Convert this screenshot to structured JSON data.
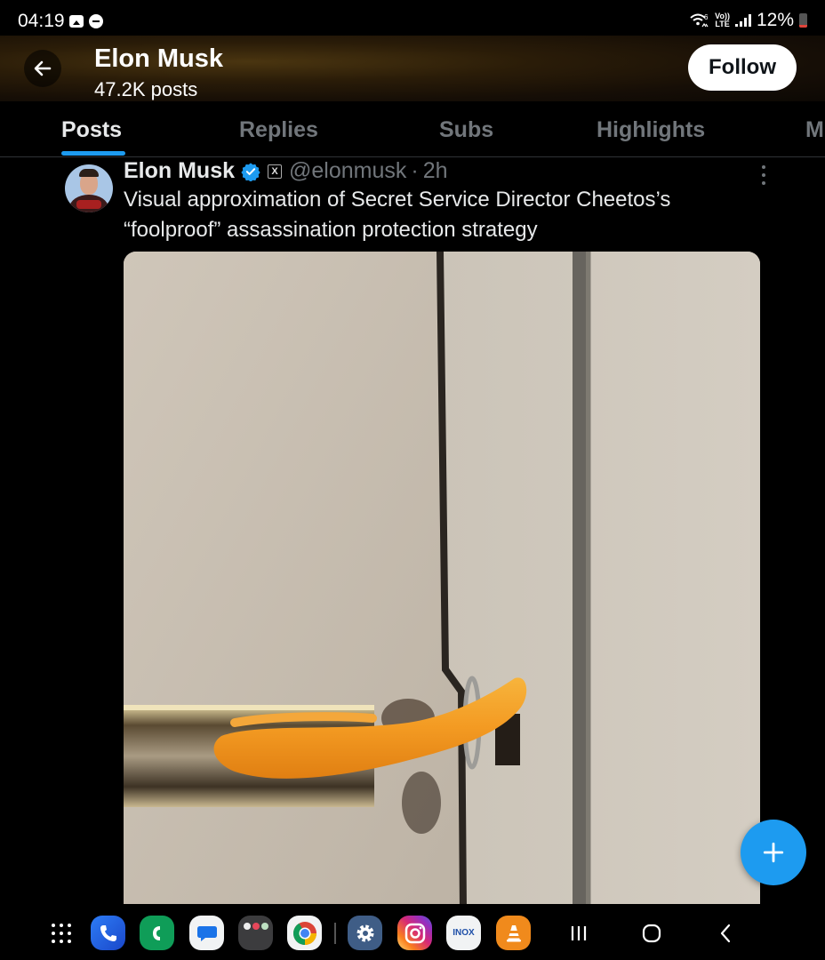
{
  "status_bar": {
    "time": "04:19",
    "left_icons": [
      "gallery-notification-icon",
      "do-not-disturb-icon"
    ],
    "wifi_label": "6",
    "network_label_top": "Vo))",
    "network_label_bottom": "LTE",
    "battery_percent": "12%"
  },
  "header": {
    "back_icon": "arrow-left-icon",
    "name": "Elon Musk",
    "posts_count": "47.2K posts",
    "follow_label": "Follow"
  },
  "tabs": [
    {
      "label": "Posts",
      "active": true
    },
    {
      "label": "Replies",
      "active": false
    },
    {
      "label": "Subs",
      "active": false
    },
    {
      "label": "Highlights",
      "active": false
    },
    {
      "label": "M",
      "active": false
    }
  ],
  "tweet": {
    "author_name": "Elon Musk",
    "verified": true,
    "affiliate_badge": "X",
    "handle": "@elonmusk",
    "separator": "·",
    "time": "2h",
    "text": "Visual approximation of Secret Service Director Cheetos’s “foolproof” assassination protection strategy",
    "media": {
      "type": "photo",
      "description": "Cheeto inserted through a door latch strike plate ring"
    }
  },
  "fab": {
    "icon": "plus-icon",
    "label": "Compose post"
  },
  "taskbar": {
    "apps": [
      {
        "name": "phone",
        "color": "#1f5fe0"
      },
      {
        "name": "call",
        "color": "#0f9d58"
      },
      {
        "name": "messages",
        "color": "#f1f3f4"
      },
      {
        "name": "folder",
        "color": "#3c3c3e"
      },
      {
        "name": "chrome",
        "color": "#f1f3f4"
      },
      {
        "name": "settings",
        "color": "#3f5d86"
      },
      {
        "name": "instagram",
        "color": "#d6249f"
      },
      {
        "name": "inox",
        "color": "#f1f3f4",
        "label": "INOX"
      },
      {
        "name": "vlc",
        "color": "#f08a1c"
      }
    ],
    "nav": [
      "recents",
      "home",
      "back"
    ]
  },
  "colors": {
    "accent": "#1d9bf0",
    "background": "#000000",
    "text_primary": "#e7e9ea",
    "text_secondary": "#71767b"
  }
}
